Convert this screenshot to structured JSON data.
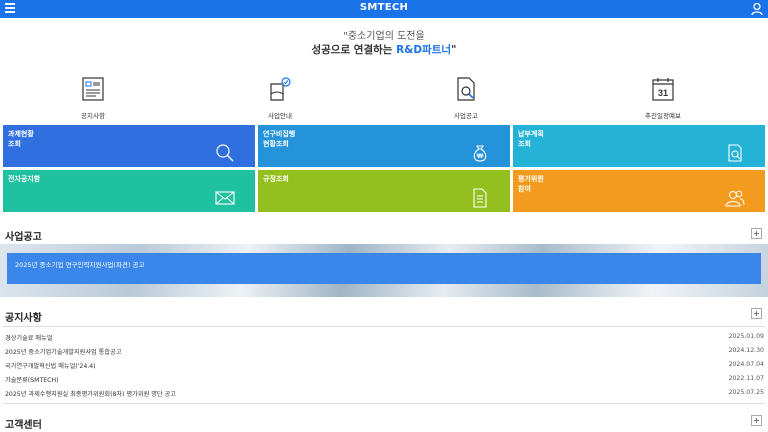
{
  "header": {
    "title": "SMTECH"
  },
  "slogan": {
    "line1": "\"중소기업의 도전을",
    "line2_prefix": "성공으로 연결하는 ",
    "line2_highlight": "R&D파트너",
    "line2_suffix": "\""
  },
  "quick_links": [
    {
      "label": "공지사항",
      "icon": "notice-board-icon"
    },
    {
      "label": "사업안내",
      "icon": "business-guide-icon"
    },
    {
      "label": "사업공고",
      "icon": "announcement-search-icon"
    },
    {
      "label": "추진일정예보",
      "icon": "calendar-icon",
      "calendar_day": "31"
    }
  ],
  "tiles": [
    {
      "line1": "과제현황",
      "line2": "조회",
      "icon": "search-icon",
      "color": "#2f6fe0"
    },
    {
      "line1": "연구비집행",
      "line2": "현황조회",
      "icon": "money-bag-icon",
      "color": "#2593d9"
    },
    {
      "line1": "납부계획",
      "line2": "조회",
      "icon": "document-search-icon",
      "color": "#24b3d6"
    },
    {
      "line1": "전자공지함",
      "line2": "",
      "icon": "envelope-icon",
      "color": "#1fc1a0"
    },
    {
      "line1": "규정조회",
      "line2": "",
      "icon": "document-icon",
      "color": "#93c01f"
    },
    {
      "line1": "평가위원",
      "line2": "참여",
      "icon": "people-icon",
      "color": "#f29b1e"
    }
  ],
  "business_notice": {
    "title": "사업공고",
    "banner_text": "2025년 중소기업 연구인력지원사업(파견) 공고"
  },
  "notices": {
    "title": "공지사항",
    "items": [
      {
        "title": "경상기술료 매뉴얼",
        "date": "2025.01.09"
      },
      {
        "title": "2025년 중소기업기술개발지원사업 통합공고",
        "date": "2024.12.30"
      },
      {
        "title": "국가연구개발혁신법 매뉴얼('24.4)",
        "date": "2024.07.04"
      },
      {
        "title": "기술분류(SMTECH)",
        "date": "2022.11.07"
      },
      {
        "title": "2025년 과제수행지원실 최종평가위원회(8차) 평가위원 명단 공고",
        "date": "2025.07.25"
      }
    ]
  },
  "customer_center": {
    "title": "고객센터"
  }
}
